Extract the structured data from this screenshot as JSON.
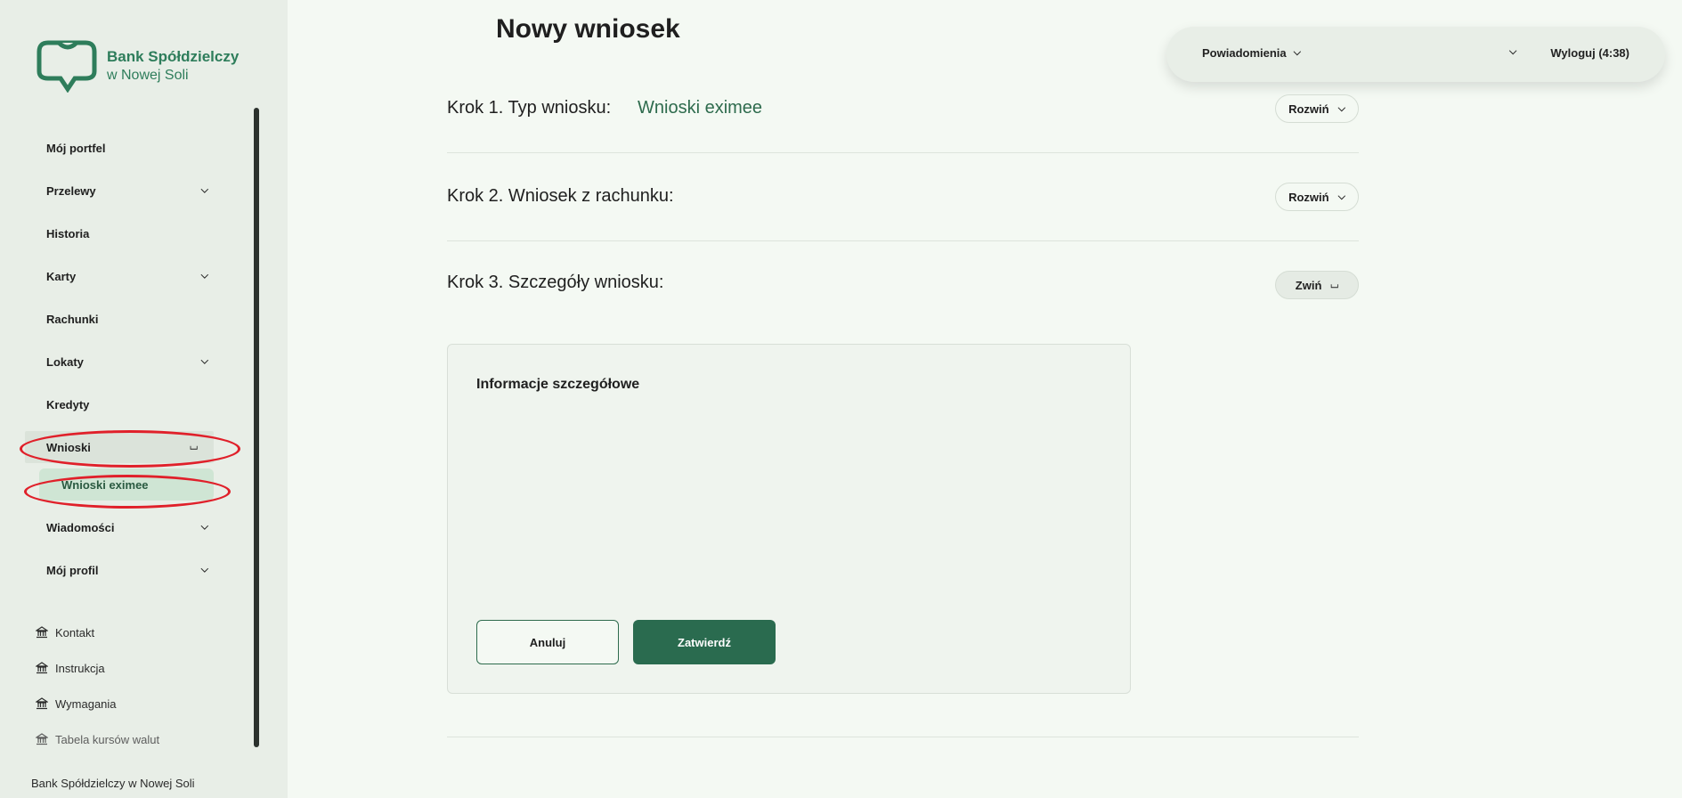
{
  "bank": {
    "name_line1": "Bank Spółdzielczy",
    "name_line2": "w Nowej Soli",
    "footer": "Bank Spółdzielczy w Nowej Soli",
    "brand_color": "#2e7d5b"
  },
  "sidebar": {
    "items": [
      {
        "label": "Mój portfel",
        "has_chevron": false
      },
      {
        "label": "Przelewy",
        "has_chevron": true
      },
      {
        "label": "Historia",
        "has_chevron": false
      },
      {
        "label": "Karty",
        "has_chevron": true
      },
      {
        "label": "Rachunki",
        "has_chevron": false
      },
      {
        "label": "Lokaty",
        "has_chevron": true
      },
      {
        "label": "Kredyty",
        "has_chevron": false
      },
      {
        "label": "Wnioski",
        "has_chevron": true,
        "expanded": true
      },
      {
        "label": "Wnioski eximee",
        "submenu": true,
        "active": true
      },
      {
        "label": "Wiadomości",
        "has_chevron": true
      },
      {
        "label": "Mój profil",
        "has_chevron": true
      }
    ],
    "links": [
      {
        "label": "Kontakt",
        "icon": "bank-icon"
      },
      {
        "label": "Instrukcja",
        "icon": "bank-icon"
      },
      {
        "label": "Wymagania",
        "icon": "bank-icon"
      },
      {
        "label": "Tabela kursów walut",
        "icon": "bank-icon"
      }
    ]
  },
  "topbar": {
    "notifications": "Powiadomienia",
    "logout": "Wyloguj (4:38)"
  },
  "main": {
    "title": "Nowy wniosek",
    "steps": [
      {
        "label": "Krok 1. Typ wniosku:",
        "value": "Wnioski eximee",
        "button": "Rozwiń",
        "button_icon": "chevron-down-icon"
      },
      {
        "label": "Krok 2. Wniosek z rachunku:",
        "value": "",
        "button": "Rozwiń",
        "button_icon": "chevron-down-icon"
      },
      {
        "label": "Krok 3. Szczegóły wniosku:",
        "value": "",
        "button": "Zwiń",
        "button_icon": "chevron-up-icon"
      }
    ],
    "details": {
      "heading": "Informacje szczegółowe",
      "cancel": "Anuluj",
      "confirm": "Zatwierdź"
    }
  },
  "colors": {
    "accent": "#2a6b4f",
    "highlight_circle": "#e0202a",
    "background": "#f4f9f3",
    "sidebar_bg": "#e8eee7"
  }
}
